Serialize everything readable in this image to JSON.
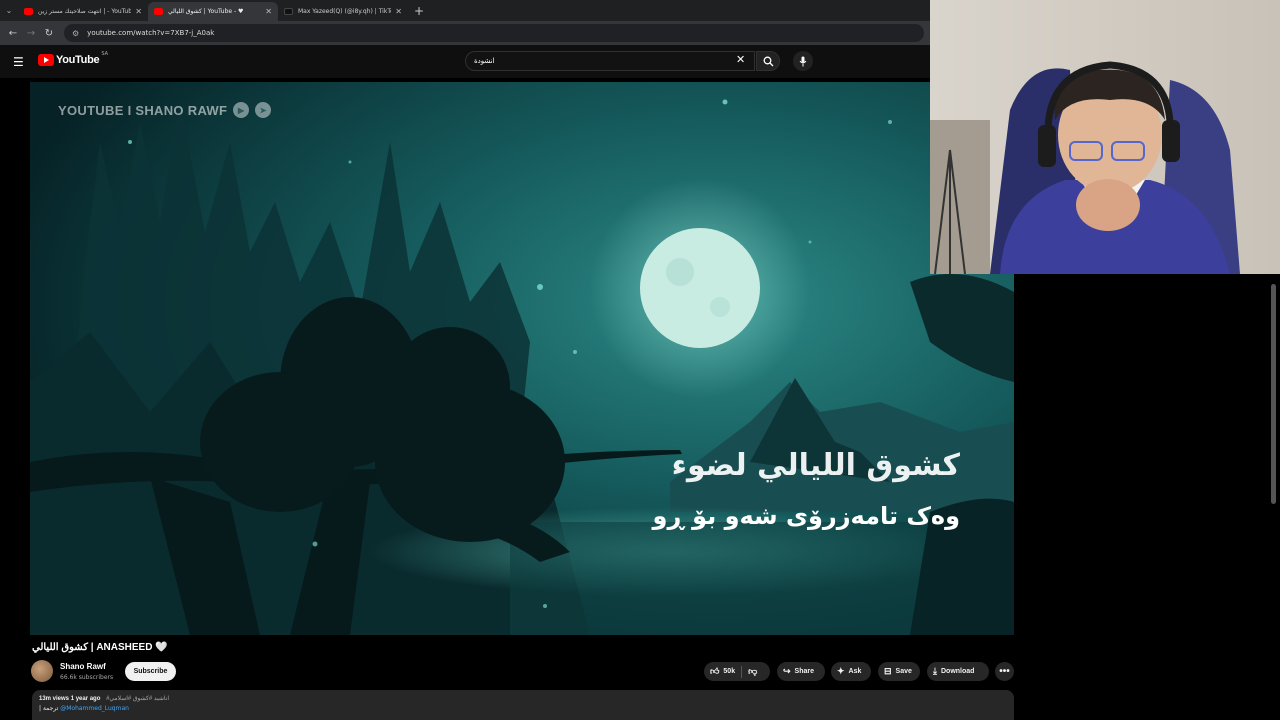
{
  "browser": {
    "tabs": [
      {
        "title": "انتهت صلاحيتك مستر زين | - YouTube"
      },
      {
        "title": "كشوق الليالي | YouTube - ♥",
        "active": true
      },
      {
        "title": "Max Yazeed(Q) (@i8y.qh) | TikTok"
      }
    ],
    "url": "youtube.com/watch?v=7XB7-j_A0ak"
  },
  "header": {
    "logo_text": "YouTube",
    "country_code": "SA",
    "search_value": "انشودة"
  },
  "video": {
    "watermark": "YOUTUBE I SHANO RAWF",
    "lyric_line1": "كشوق الليالي لضوء",
    "lyric_line2": "وەک تامەزرۆی شەو بۆ ڕو"
  },
  "info": {
    "title": "كشوق الليالي | ANASHEED 🤍",
    "channel_name": "Shano Rawf",
    "subscribers": "66.6k subscribers",
    "subscribe_label": "Subscribe",
    "likes": "50k",
    "share_label": "Share",
    "ask_label": "Ask",
    "save_label": "Save",
    "download_label": "Download",
    "more_label": "•••",
    "views": "13m views",
    "age": "1 year ago",
    "hashtags": "#اناشيد #كشوق #اسلامي",
    "desc_prefix": "| ترجمة ",
    "desc_mention": "@Mohammed_Luqman"
  },
  "colors": {
    "brand_red": "#ff0000",
    "bg": "#0f0f0f",
    "pill": "#272727",
    "link": "#3ea6ff"
  },
  "icons": [
    "chevron-down-icon",
    "close-icon",
    "plus-icon",
    "back-icon",
    "forward-icon",
    "reload-icon",
    "site-info-icon",
    "hamburger-icon",
    "search-icon",
    "mic-icon",
    "like-icon",
    "dislike-icon",
    "share-icon",
    "sparkle-icon",
    "bookmark-icon",
    "download-icon",
    "more-icon"
  ]
}
